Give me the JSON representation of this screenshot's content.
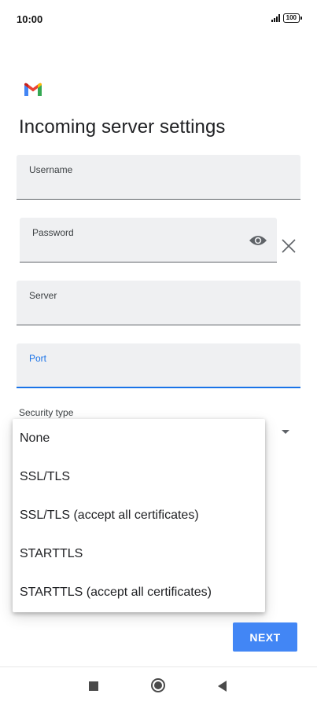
{
  "status_bar": {
    "time": "10:00",
    "battery": "100"
  },
  "app": {
    "logo_icon": "gmail-logo-icon",
    "brand_colors": [
      "#4285f4",
      "#ea4335",
      "#fbbc04",
      "#34a853"
    ]
  },
  "page": {
    "title": "Incoming server settings"
  },
  "fields": {
    "username": {
      "label": "Username",
      "value": ""
    },
    "password": {
      "label": "Password",
      "value": "",
      "toggle_icon": "eye-icon",
      "clear_icon": "close-icon"
    },
    "server": {
      "label": "Server",
      "value": ""
    },
    "port": {
      "label": "Port",
      "value": "",
      "focused": true
    },
    "security_type": {
      "label": "Security type",
      "icon": "caret-down-icon"
    }
  },
  "dropdown": {
    "options": [
      "None",
      "SSL/TLS",
      "SSL/TLS (accept all certificates)",
      "STARTTLS",
      "STARTTLS (accept all certificates)"
    ]
  },
  "actions": {
    "next_label": "NEXT"
  },
  "nav_bar": {
    "recents_icon": "square-icon",
    "home_icon": "circle-icon",
    "back_icon": "back-triangle-icon"
  },
  "colors": {
    "accent": "#1a73e8",
    "button": "#4286f5",
    "field_bg": "#eff0f2"
  }
}
